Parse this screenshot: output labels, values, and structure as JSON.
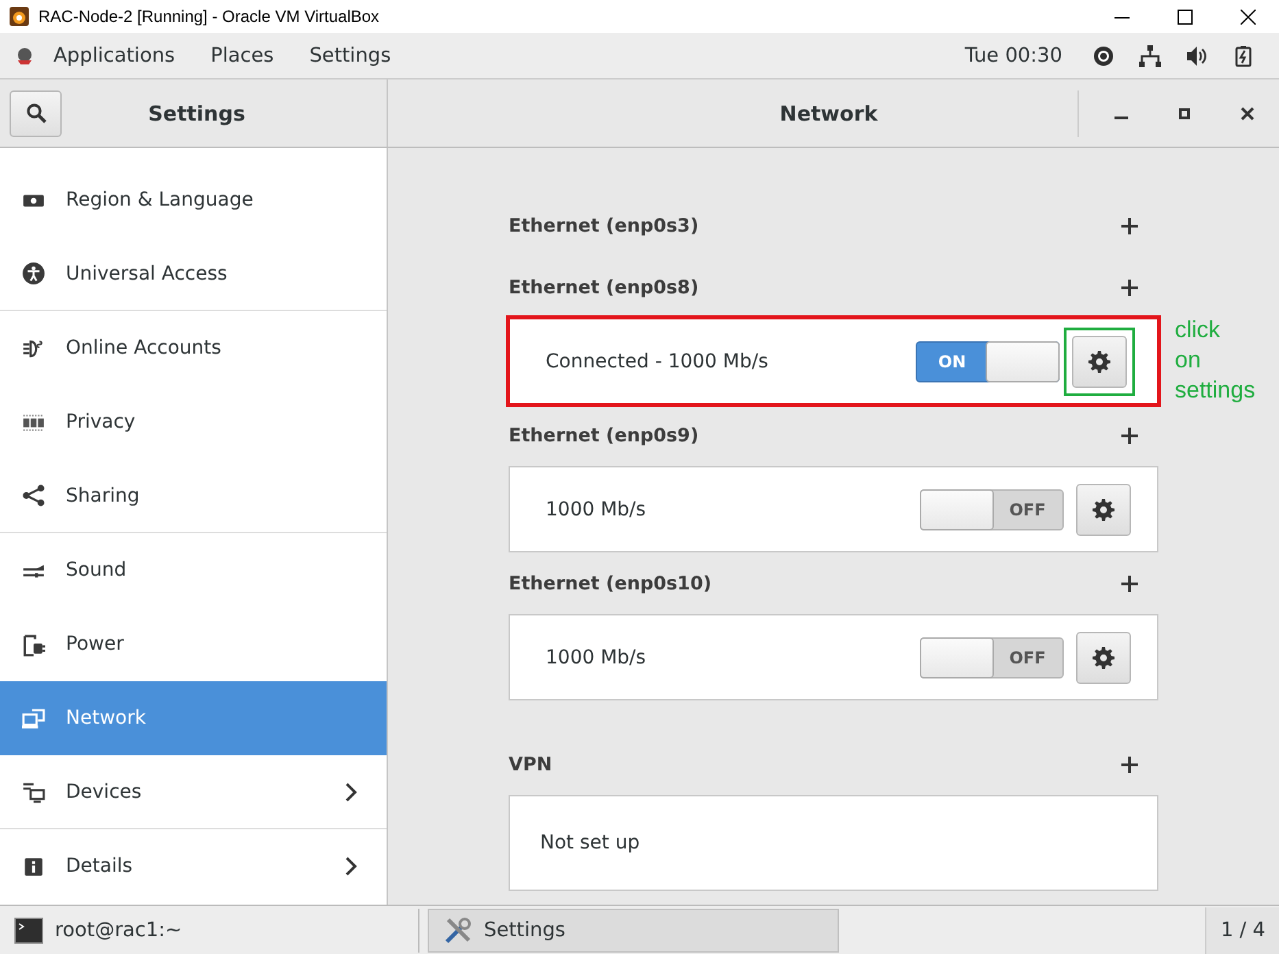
{
  "window": {
    "title": "RAC-Node-2 [Running] - Oracle VM VirtualBox"
  },
  "top_bar": {
    "menus": [
      "Applications",
      "Places",
      "Settings"
    ],
    "clock": "Tue 00:30"
  },
  "header": {
    "left_title": "Settings",
    "title": "Network"
  },
  "sidebar": {
    "items": [
      {
        "label": "Region & Language",
        "selected": false,
        "chevron": false,
        "divider_after": false
      },
      {
        "label": "Universal Access",
        "selected": false,
        "chevron": false,
        "divider_after": true
      },
      {
        "label": "Online Accounts",
        "selected": false,
        "chevron": false,
        "divider_after": false
      },
      {
        "label": "Privacy",
        "selected": false,
        "chevron": false,
        "divider_after": false
      },
      {
        "label": "Sharing",
        "selected": false,
        "chevron": false,
        "divider_after": true
      },
      {
        "label": "Sound",
        "selected": false,
        "chevron": false,
        "divider_after": false
      },
      {
        "label": "Power",
        "selected": false,
        "chevron": false,
        "divider_after": false
      },
      {
        "label": "Network",
        "selected": true,
        "chevron": false,
        "divider_after": false
      },
      {
        "label": "Devices",
        "selected": false,
        "chevron": true,
        "divider_after": true
      },
      {
        "label": "Details",
        "selected": false,
        "chevron": true,
        "divider_after": false
      }
    ]
  },
  "sections": [
    {
      "title": "Ethernet (enp0s3)",
      "kind": "header"
    },
    {
      "title": "Ethernet (enp0s8)",
      "kind": "device",
      "status": "Connected - 1000 Mb/s",
      "on": true,
      "switch_label": "ON",
      "highlighted": true,
      "annotation": {
        "kind": "gear_box",
        "text": "click\non\nsettings"
      }
    },
    {
      "title": "Ethernet (enp0s9)",
      "kind": "device",
      "status": "1000 Mb/s",
      "on": false,
      "switch_label": "OFF",
      "highlighted": false
    },
    {
      "title": "Ethernet (enp0s10)",
      "kind": "device",
      "status": "1000 Mb/s",
      "on": false,
      "switch_label": "OFF",
      "highlighted": false
    },
    {
      "title": "VPN",
      "kind": "empty",
      "status": "Not set up"
    }
  ],
  "taskbar": {
    "items": [
      {
        "label": "root@rac1:~",
        "kind": "terminal",
        "selected": false
      },
      {
        "label": "Settings",
        "kind": "tools",
        "selected": true
      }
    ],
    "workspace": "1 / 4"
  }
}
